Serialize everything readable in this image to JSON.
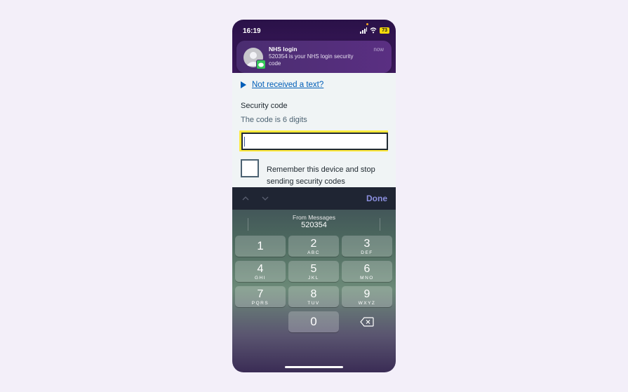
{
  "status_bar": {
    "time": "16:19",
    "battery": "73"
  },
  "notification": {
    "app": "NHS login",
    "message": "520354 is your NHS login security code",
    "time": "now",
    "avatar_icon": "person-avatar-icon",
    "badge_icon": "messages-icon"
  },
  "form": {
    "details_link": "Not received a text?",
    "label": "Security code",
    "hint": "The code is 6 digits",
    "input_value": "",
    "remember_label": "Remember this device and stop sending security codes"
  },
  "keyboard_toolbar": {
    "done_label": "Done"
  },
  "suggestion": {
    "from": "From Messages",
    "code": "520354"
  },
  "keys": [
    {
      "num": "1",
      "letters": ""
    },
    {
      "num": "2",
      "letters": "ABC"
    },
    {
      "num": "3",
      "letters": "DEF"
    },
    {
      "num": "4",
      "letters": "GHI"
    },
    {
      "num": "5",
      "letters": "JKL"
    },
    {
      "num": "6",
      "letters": "MNO"
    },
    {
      "num": "7",
      "letters": "PQRS"
    },
    {
      "num": "8",
      "letters": "TUV"
    },
    {
      "num": "9",
      "letters": "WXYZ"
    },
    {
      "num": "0",
      "letters": ""
    }
  ],
  "colors": {
    "accent": "#005eb8",
    "focus": "#ffeb3b",
    "brand_purple": "#3d1a5e"
  }
}
